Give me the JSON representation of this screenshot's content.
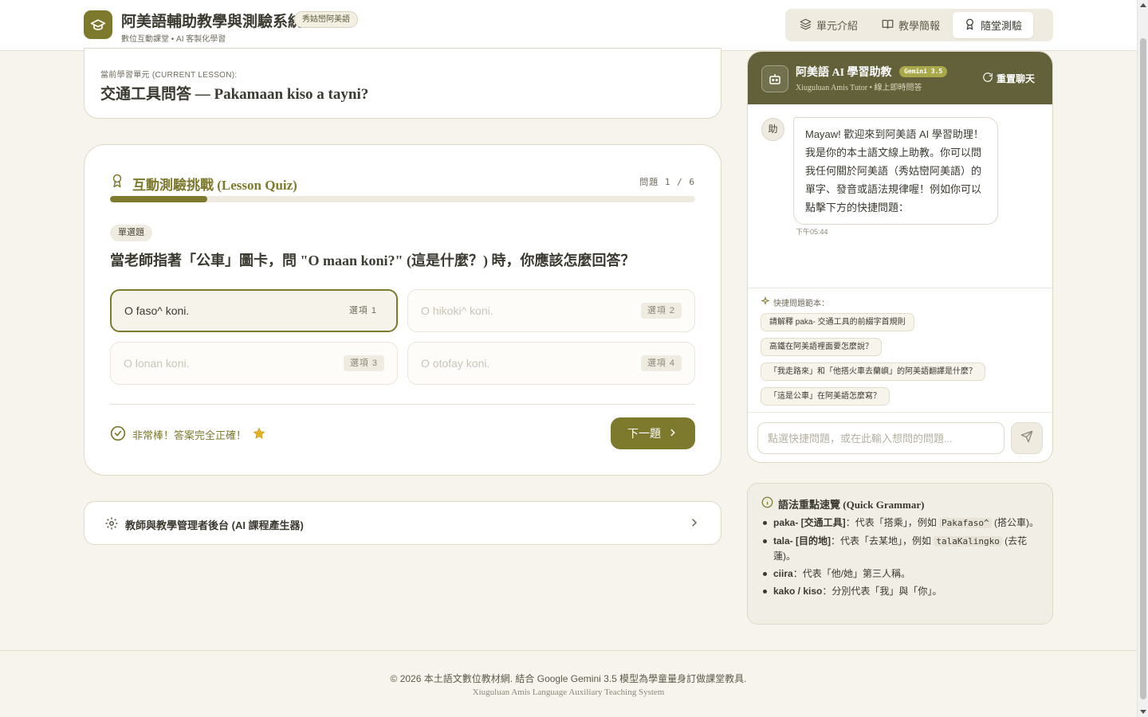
{
  "header": {
    "title": "阿美語輔助教學與測驗系統",
    "badge": "秀姑巒阿美語",
    "subtitle": "數位互動課堂 • AI 客製化學習",
    "nav": [
      {
        "label": "單元介紹",
        "icon": "layers-icon"
      },
      {
        "label": "教學簡報",
        "icon": "book-icon"
      },
      {
        "label": "隨堂測驗",
        "icon": "award-icon",
        "active": true
      }
    ]
  },
  "lesson": {
    "label": "當前學習單元 (CURRENT LESSON):",
    "title": "交通工具問答 — Pakamaan kiso a tayni?"
  },
  "quiz": {
    "title": "互動測驗挑戰 (Lesson Quiz)",
    "counter": "問題 1 / 6",
    "progress": 0.1667,
    "question_type": "單選題",
    "question": "當老師指著「公車」圖卡，問 \"O maan koni?\" (這是什麼？) 時，你應該怎麼回答？",
    "options": [
      {
        "text": "O faso^ koni.",
        "tag": "選項 1",
        "selected": true
      },
      {
        "text": "O hikoki^ koni.",
        "tag": "選項 2"
      },
      {
        "text": "O lonan koni.",
        "tag": "選項 3"
      },
      {
        "text": "O otofay koni.",
        "tag": "選項 4"
      }
    ],
    "feedback": "非常棒！答案完全正確！",
    "next_label": "下一題"
  },
  "admin": {
    "label": "教師與教學管理者後台 (AI 課程產生器)"
  },
  "chat": {
    "title": "阿美語 AI 學習助教",
    "model": "Gemini 3.5",
    "subtitle": "Xiuguluan Amis Tutor • 線上即時問答",
    "reset_label": "重置聊天",
    "avatar_text": "助",
    "message": "Mayaw! 歡迎來到阿美語 AI 學習助理！我是你的本土語文線上助教。你可以問我任何關於阿美語（秀姑巒阿美語）的單字、發音或語法規律喔！例如你可以點擊下方的快捷問題：",
    "time": "下午05:44",
    "quick_label": "快捷問題範本：",
    "quick_questions": [
      "請解釋 paka- 交通工具的前綴字首規則",
      "高鐵在阿美語裡面要怎麼說？",
      "「我走路來」和「他搭火車去蘭嶼」的阿美語翻譯是什麼？",
      "「這是公車」在阿美語怎麼寫？"
    ],
    "input_placeholder": "點選快捷問題，或在此輸入想問的問題..."
  },
  "grammar": {
    "title": "語法重點速覽 (Quick Grammar)",
    "items": [
      {
        "term": "paka- [交通工具]",
        "desc": "：代表「搭乘」，例如 ",
        "code": "Pakafaso^",
        "tail": " (搭公車)。"
      },
      {
        "term": "tala- [目的地]",
        "desc": "：代表「去某地」，例如 ",
        "code": "talaKalingko",
        "tail": " (去花蓮)。"
      },
      {
        "term": "ciira",
        "desc": "：代表「他/她」第三人稱。",
        "code": "",
        "tail": ""
      },
      {
        "term": "kako / kiso",
        "desc": "：分別代表「我」與「你」。",
        "code": "",
        "tail": ""
      }
    ]
  },
  "footer": {
    "line1": "© 2026 本土語文數位教材網. 結合 Google Gemini 3.5 模型為學童量身訂做課堂教具.",
    "line2": "Xiuguluan Amis Language Auxiliary Teaching System"
  },
  "colors": {
    "accent": "#7d7a2e",
    "chat_header": "#63613a",
    "background": "#f7f4ee",
    "star": "#e0b422"
  }
}
